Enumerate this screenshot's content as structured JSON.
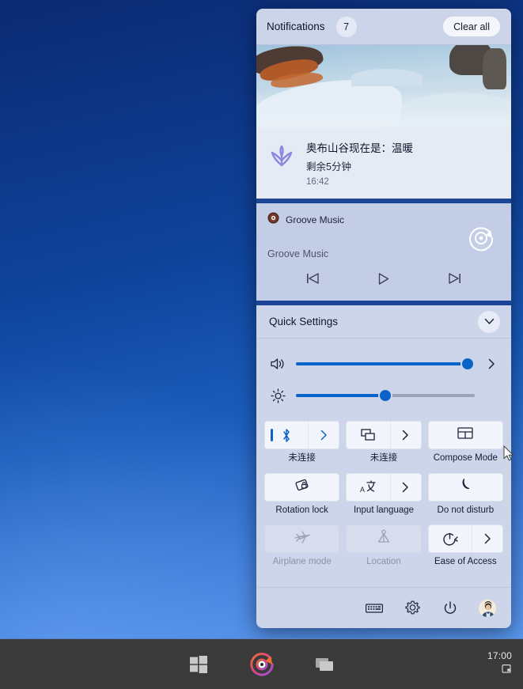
{
  "desktop": {
    "wallpaper_top_color": "#0b2a72",
    "wallpaper_bottom_color": "#5c9aef"
  },
  "taskbar": {
    "background_color": "#3a3a3a",
    "buttons": [
      {
        "name": "start-button",
        "icon": "windows-logo-icon",
        "label": "Start"
      },
      {
        "name": "groove-music-taskbar-button",
        "icon": "groove-music-icon",
        "label": "Groove Music"
      },
      {
        "name": "task-view-button",
        "icon": "task-view-icon",
        "label": "Task view"
      }
    ],
    "tray": {
      "clock": "17:00",
      "notification_icon": "action-center-icon"
    }
  },
  "notifications": {
    "title": "Notifications",
    "count": "7",
    "clear_all_label": "Clear all",
    "items": [
      {
        "app_icon": "crocus-flower-icon",
        "headline": "奥布山谷现在是：温暖",
        "subtext": "剩余5分钟",
        "time": "16:42",
        "has_hero_image": true,
        "hero_image_description": "snowy mountain valley with rust colored rock formations"
      }
    ]
  },
  "groove": {
    "app_name": "Groove Music",
    "app_icon": "groove-music-icon",
    "track_title": "Groove Music",
    "album_art_icon": "groove-music-logo-icon",
    "controls": [
      {
        "name": "previous-track-button",
        "glyph": "previous-icon"
      },
      {
        "name": "play-button",
        "glyph": "play-icon"
      },
      {
        "name": "next-track-button",
        "glyph": "next-icon"
      }
    ]
  },
  "quick_settings": {
    "title": "Quick Settings",
    "collapse_icon": "chevron-down-icon",
    "accent_color": "#0a63c9",
    "sliders": [
      {
        "name": "volume-slider",
        "icon": "speaker-icon",
        "value": 96,
        "has_chevron": true
      },
      {
        "name": "brightness-slider",
        "icon": "brightness-icon",
        "value": 50,
        "has_chevron": false
      }
    ],
    "tiles": [
      {
        "name": "bluetooth-tile",
        "label": "未连接",
        "icon": "bluetooth-icon",
        "active": true,
        "disabled": false,
        "has_chevron": true
      },
      {
        "name": "cast-tile",
        "label": "未连接",
        "icon": "cast-icon",
        "active": false,
        "disabled": false,
        "has_chevron": true
      },
      {
        "name": "compose-mode-tile",
        "label": "Compose Mode",
        "icon": "compose-mode-icon",
        "active": false,
        "disabled": false,
        "has_chevron": false
      },
      {
        "name": "rotation-lock-tile",
        "label": "Rotation lock",
        "icon": "rotation-lock-icon",
        "active": false,
        "disabled": false,
        "has_chevron": false
      },
      {
        "name": "input-language-tile",
        "label": "Input language",
        "icon": "input-language-icon",
        "active": false,
        "disabled": false,
        "has_chevron": true
      },
      {
        "name": "do-not-disturb-tile",
        "label": "Do not disturb",
        "icon": "moon-icon",
        "active": false,
        "disabled": false,
        "has_chevron": false
      },
      {
        "name": "airplane-mode-tile",
        "label": "Airplane mode",
        "icon": "airplane-icon",
        "active": false,
        "disabled": true,
        "has_chevron": false
      },
      {
        "name": "location-tile",
        "label": "Location",
        "icon": "location-icon",
        "active": false,
        "disabled": true,
        "has_chevron": false
      },
      {
        "name": "ease-of-access-tile",
        "label": "Ease of Access",
        "icon": "ease-of-access-icon",
        "active": false,
        "disabled": false,
        "has_chevron": true
      }
    ],
    "footer": [
      {
        "name": "touch-keyboard-button",
        "icon": "keyboard-icon"
      },
      {
        "name": "settings-button",
        "icon": "gear-icon"
      },
      {
        "name": "power-button",
        "icon": "power-icon"
      },
      {
        "name": "user-avatar",
        "icon": "avatar-icon"
      }
    ]
  }
}
